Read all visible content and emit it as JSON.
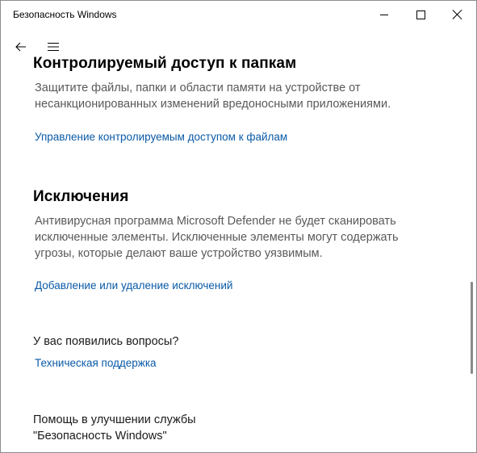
{
  "window": {
    "title": "Безопасность Windows"
  },
  "nav": {
    "back_icon": "arrow-left-icon",
    "menu_icon": "hamburger-icon"
  },
  "folders": {
    "heading": "Контролируемый доступ к папкам",
    "description_line1": "Защитите файлы, папки и области памяти на устройстве от",
    "description_line2": "несанкционированных изменений вредоносными приложениями.",
    "link": "Управление контролируемым доступом к файлам"
  },
  "exclusions": {
    "heading": "Исключения",
    "description_line1": "Антивирусная программа Microsoft Defender не будет сканировать",
    "description_line2": "исключенные элементы. Исключенные элементы могут содержать",
    "description_line3": "угрозы, которые делают ваше устройство уязвимым.",
    "link": "Добавление или удаление исключений"
  },
  "questions": {
    "heading": "У вас появились вопросы?",
    "link": "Техническая поддержка"
  },
  "improve": {
    "line1": "Помощь в улучшении службы",
    "line2": "\"Безопасность Windows\""
  },
  "colors": {
    "link": "#0a5aa8",
    "description": "#595959",
    "border": "#8c8c8c"
  }
}
